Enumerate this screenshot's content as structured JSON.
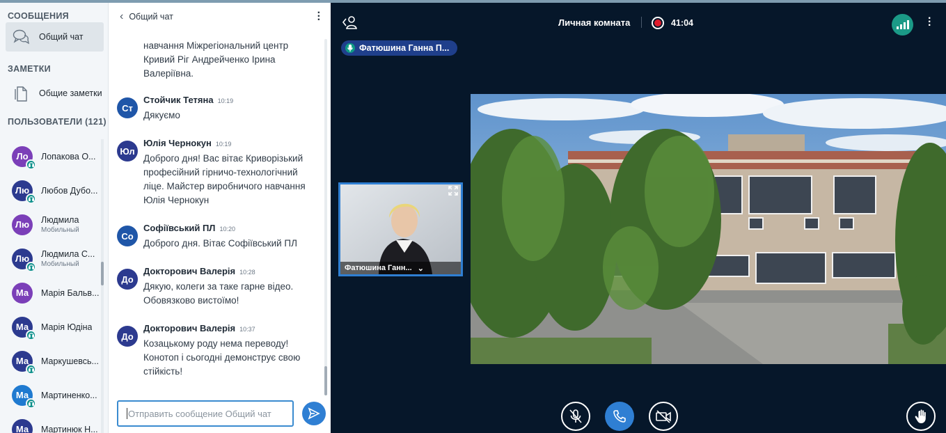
{
  "nav": {
    "messages_heading": "СООБЩЕНИЯ",
    "public_chat": "Общий чат",
    "notes_heading": "ЗАМЕТКИ",
    "shared_notes": "Общие заметки",
    "users_heading": "ПОЛЬЗОВАТЕЛИ (121)",
    "users": [
      {
        "initials": "Ло",
        "name": "Лопакова О...",
        "sub": "",
        "color": "#7b3fb8",
        "badge": true
      },
      {
        "initials": "Лю",
        "name": "Любов Дубо...",
        "sub": "",
        "color": "#2c3a8f",
        "badge": true
      },
      {
        "initials": "Лю",
        "name": "Людмила",
        "sub": "Мобильный",
        "color": "#7b3fb8",
        "badge": false
      },
      {
        "initials": "Лю",
        "name": "Людмила С...",
        "sub": "Мобильный",
        "color": "#2c3a8f",
        "badge": true
      },
      {
        "initials": "Ма",
        "name": "Марія Бальв...",
        "sub": "",
        "color": "#7b3fb8",
        "badge": false
      },
      {
        "initials": "Ма",
        "name": "Марія Юдіна",
        "sub": "",
        "color": "#2c3a8f",
        "badge": true
      },
      {
        "initials": "Ма",
        "name": "Маркушевсь...",
        "sub": "",
        "color": "#2c3a8f",
        "badge": true
      },
      {
        "initials": "Ма",
        "name": "Мартиненко...",
        "sub": "",
        "color": "#1f7ad0",
        "badge": true
      },
      {
        "initials": "Ма",
        "name": "Мартинюк Н...",
        "sub": "",
        "color": "#2c3a8f",
        "badge": false
      }
    ]
  },
  "chat": {
    "title": "Общий чат",
    "partial_text": "навчання Міжрегіональний центр Кривий Ріг Андрейченко Ірина Валеріївна.",
    "messages": [
      {
        "initials": "Ст",
        "author": "Стойчик Тетяна",
        "time": "10:19",
        "text": "Дякуємо",
        "color": "#1f56a8"
      },
      {
        "initials": "Юл",
        "author": "Юлія Чернокун",
        "time": "10:19",
        "text": "Доброго дня! Вас вітає Криворізький професійний гірничо-технологічний ліце. Майстер виробничого навчання Юлія Чернокун",
        "color": "#2c3a8f"
      },
      {
        "initials": "Со",
        "author": "Софіївський ПЛ",
        "time": "10:20",
        "text": "Доброго дня. Вітає Софіївський ПЛ",
        "color": "#1f56a8"
      },
      {
        "initials": "До",
        "author": "Докторович Валерія",
        "time": "10:28",
        "text": "Дякую, колеги за таке гарне відео. Обовязково вистоїмо!",
        "color": "#2c3a8f"
      },
      {
        "initials": "До",
        "author": "Докторович Валерія",
        "time": "10:37",
        "text": "Козацькому роду нема переводу! Конотоп і сьогодні демонструє свою стійкість!",
        "color": "#2c3a8f"
      }
    ],
    "input_placeholder": "Отправить сообщение Общий чат"
  },
  "media": {
    "room_title": "Личная комната",
    "recording_time": "41:04",
    "talking_indicator": "Фатюшина Ганна П...",
    "webcam_name": "Фатюшина Ганн...",
    "icons": [
      "user-switch-icon",
      "record-icon",
      "connection-status-icon",
      "mic-muted-icon",
      "phone-icon",
      "camera-off-icon",
      "raise-hand-icon"
    ],
    "accent": "#2f7fd3",
    "record_color": "#e01b2c"
  }
}
